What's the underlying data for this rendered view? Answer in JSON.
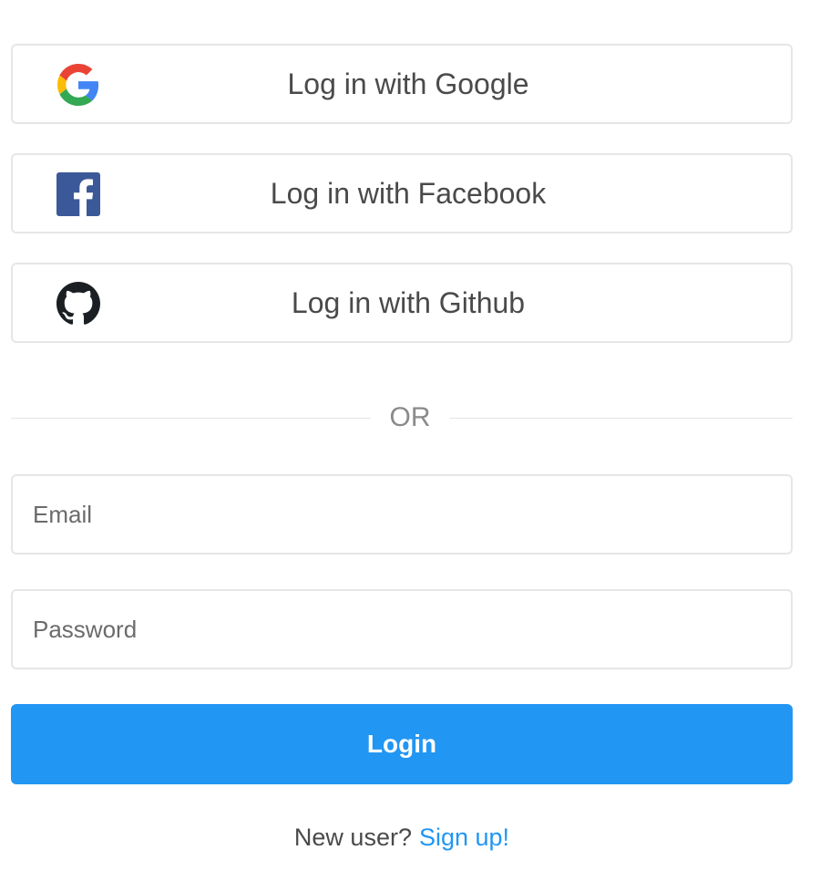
{
  "social": {
    "google_label": "Log in with Google",
    "facebook_label": "Log in with Facebook",
    "github_label": "Log in with Github"
  },
  "icons": {
    "google": "google-g-logo",
    "facebook": "facebook-logo",
    "github": "github-logo"
  },
  "divider": {
    "text": "OR"
  },
  "form": {
    "email_placeholder": "Email",
    "email_value": "",
    "password_placeholder": "Password",
    "password_value": ""
  },
  "login_button": {
    "label": "Login"
  },
  "footer": {
    "prompt": "New user?",
    "signup_link": "Sign up!"
  },
  "colors": {
    "primary": "#2196f3",
    "border": "#e6e6e6",
    "text": "#4a4a4a",
    "facebook_blue": "#3b5998",
    "google_blue": "#4285F4",
    "google_red": "#EA4335",
    "google_yellow": "#FBBC05",
    "google_green": "#34A853"
  }
}
